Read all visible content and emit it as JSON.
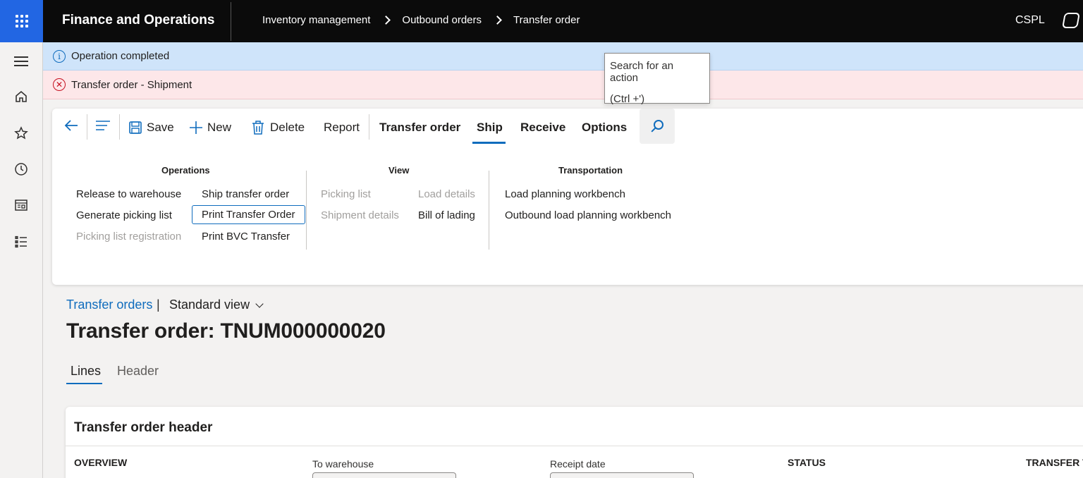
{
  "header": {
    "app_title": "Finance and Operations",
    "breadcrumb": [
      "Inventory management",
      "Outbound orders",
      "Transfer order"
    ],
    "company": "CSPL"
  },
  "messages": {
    "info": "Operation completed",
    "error": "Transfer order - Shipment"
  },
  "action_pane": {
    "save": "Save",
    "new": "New",
    "delete": "Delete",
    "report": "Report",
    "tabs": [
      "Transfer order",
      "Ship",
      "Receive",
      "Options"
    ],
    "active_tab": "Ship"
  },
  "tooltip": {
    "line1": "Search for an action",
    "line2": "(Ctrl +')"
  },
  "groups": {
    "operations": {
      "title": "Operations",
      "release_to_warehouse": "Release to warehouse",
      "generate_picking_list": "Generate picking list",
      "picking_list_registration": "Picking list registration",
      "ship_transfer_order": "Ship transfer order",
      "print_transfer_order": "Print Transfer Order",
      "print_bvc_transfer": "Print BVC Transfer"
    },
    "view": {
      "title": "View",
      "picking_list": "Picking list",
      "shipment_details": "Shipment details",
      "load_details": "Load details",
      "bill_of_lading": "Bill of lading"
    },
    "transportation": {
      "title": "Transportation",
      "load_planning_workbench": "Load planning workbench",
      "outbound_load_planning_workbench": "Outbound load planning workbench"
    }
  },
  "page": {
    "list_link": "Transfer orders",
    "separator": "|",
    "view_name": "Standard view",
    "title": "Transfer order: TNUM000000020",
    "tabs": [
      "Lines",
      "Header"
    ]
  },
  "card": {
    "title": "Transfer order header",
    "overview": "OVERVIEW",
    "to_warehouse": "To warehouse",
    "receipt_date": "Receipt date",
    "status": "STATUS",
    "transfer": "TRANSFER T"
  },
  "colors": {
    "accent": "#0f6cbd",
    "waffle": "#2266e3",
    "info_bg": "#cfe4fa",
    "error_bg": "#fde7e9"
  }
}
